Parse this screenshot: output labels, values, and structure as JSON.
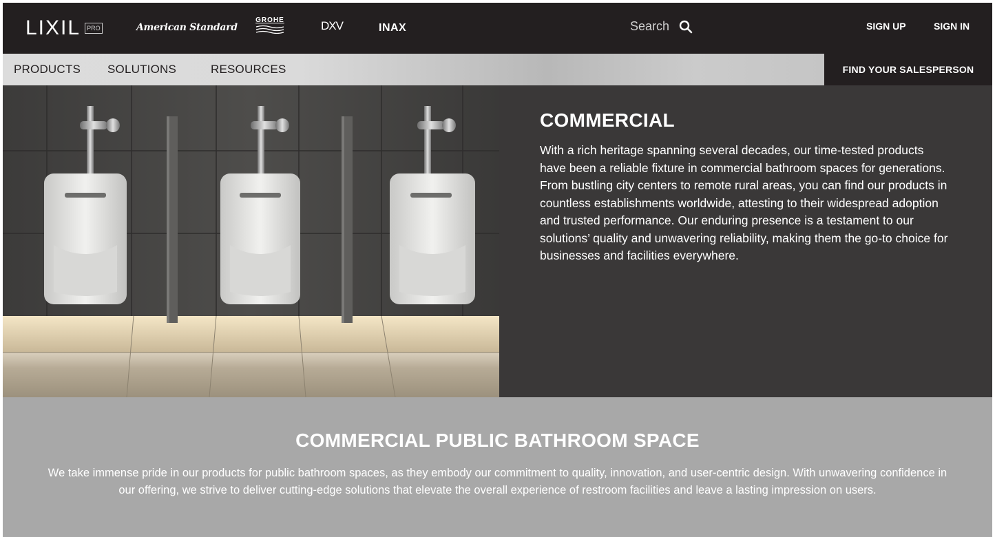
{
  "header": {
    "logo": "LIXIL",
    "logo_badge": "PRO",
    "brands": {
      "american_standard": "American Standard",
      "grohe": "GROHE",
      "dxv": "DXV",
      "inax": "INAX"
    },
    "search_placeholder": "Search",
    "sign_up": "SIGN UP",
    "sign_in": "SIGN IN"
  },
  "nav": {
    "items": [
      "PRODUCTS",
      "SOLUTIONS",
      "RESOURCES"
    ],
    "cta": "FIND YOUR SALESPERSON"
  },
  "hero": {
    "title": "COMMERCIAL",
    "body": "With a rich heritage spanning several decades, our time-tested products have been a reliable fixture in commercial bathroom spaces for generations. From bustling city centers to remote rural areas, you can find our products in countless establishments worldwide, attesting to their widespread adoption and trusted performance. Our enduring presence is a testament to our solutions’ quality and unwavering reliability, making them the go-to choice for businesses and facilities everywhere."
  },
  "section": {
    "title": "COMMERCIAL PUBLIC BATHROOM SPACE",
    "body": "We take immense pride in our products for public bathroom spaces, as they embody our commitment to quality, innovation, and user-centric design. With unwavering confidence in our offering, we strive to deliver cutting-edge solutions that elevate the overall experience of restroom facilities and leave a lasting impression on users."
  },
  "colors": {
    "header_bg": "#231f20",
    "nav_bg": "#d4d4d4",
    "hero_text_bg": "#3a3838",
    "band_bg": "#a8a8a8"
  }
}
